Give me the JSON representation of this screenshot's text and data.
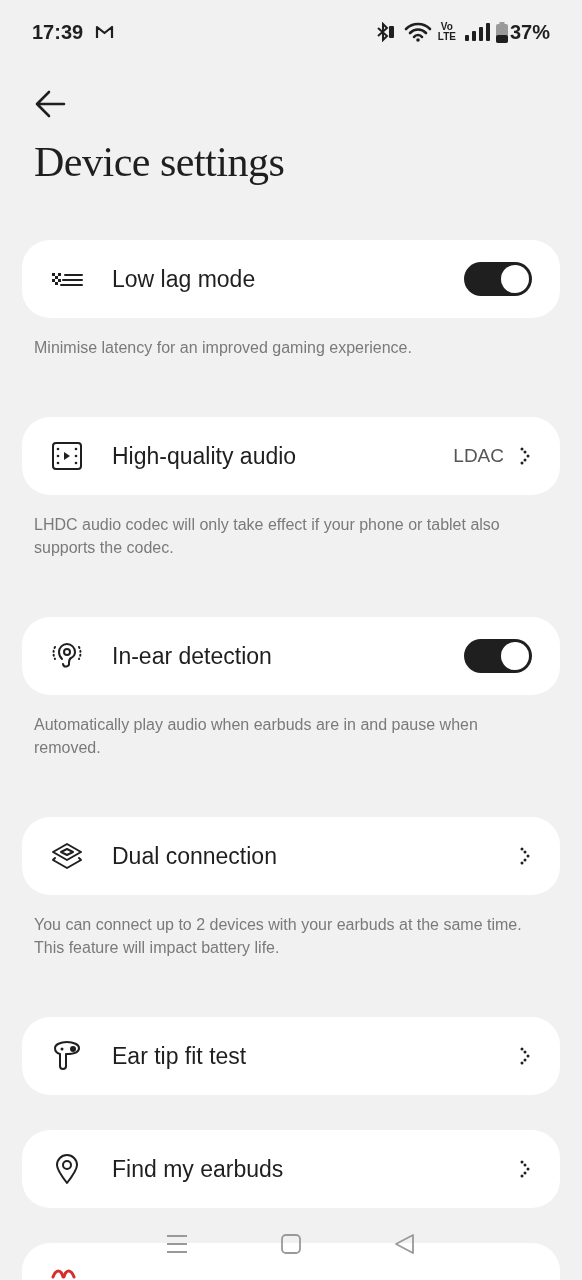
{
  "status_bar": {
    "time": "17:39",
    "volte_top": "Vo",
    "volte_bottom": "LTE",
    "battery": "37%"
  },
  "title": "Device settings",
  "items": [
    {
      "kind": "toggle",
      "label": "Low lag mode",
      "on": true,
      "description": "Minimise latency for an improved gaming experience."
    },
    {
      "kind": "link",
      "label": "High-quality audio",
      "value": "LDAC",
      "description": "LHDC audio codec will only take effect if your phone or tablet also supports the codec."
    },
    {
      "kind": "toggle",
      "label": "In-ear detection",
      "on": true,
      "description": "Automatically play audio when earbuds are in and pause when removed."
    },
    {
      "kind": "link",
      "label": "Dual connection",
      "description": "You can connect up to 2 devices with your earbuds at the same time. This feature will impact battery life."
    },
    {
      "kind": "link",
      "label": "Ear tip fit test"
    },
    {
      "kind": "link",
      "label": "Find my earbuds"
    },
    {
      "kind": "danger"
    }
  ]
}
